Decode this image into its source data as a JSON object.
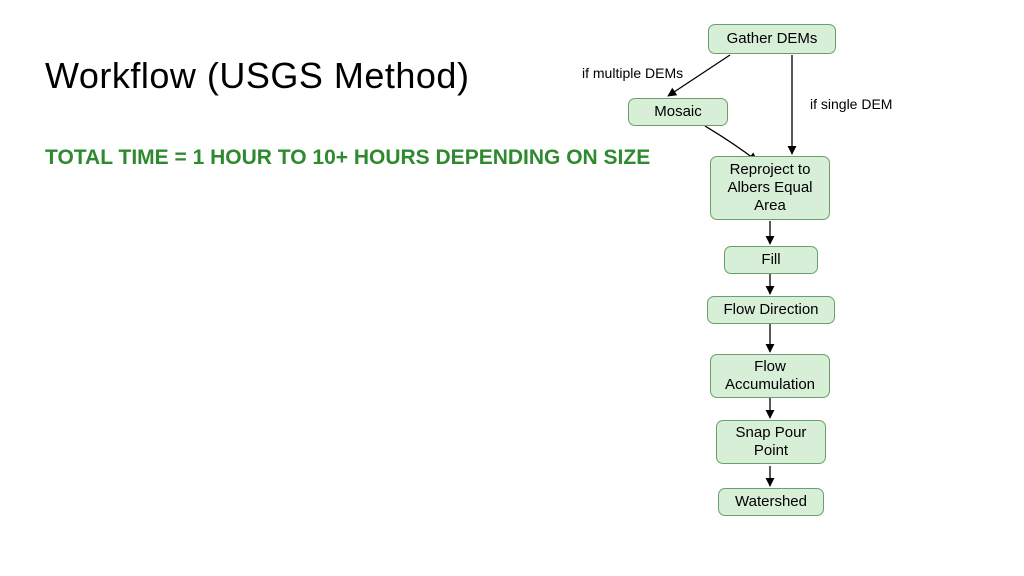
{
  "title": "Workflow (USGS Method)",
  "subtitle": "TOTAL TIME = 1 HOUR TO 10+ HOURS DEPENDING ON SIZE",
  "flow": {
    "nodes": {
      "gather": "Gather DEMs",
      "mosaic": "Mosaic",
      "reproject": "Reproject to Albers Equal Area",
      "fill": "Fill",
      "flowdir": "Flow Direction",
      "flowacc": "Flow Accumulation",
      "snap": "Snap Pour Point",
      "watershed": "Watershed"
    },
    "edge_labels": {
      "multi": "if multiple DEMs",
      "single": "if single DEM"
    },
    "edges": [
      {
        "from": "gather",
        "to": "mosaic",
        "label": "multi"
      },
      {
        "from": "gather",
        "to": "reproject",
        "label": "single"
      },
      {
        "from": "mosaic",
        "to": "reproject"
      },
      {
        "from": "reproject",
        "to": "fill"
      },
      {
        "from": "fill",
        "to": "flowdir"
      },
      {
        "from": "flowdir",
        "to": "flowacc"
      },
      {
        "from": "flowacc",
        "to": "snap"
      },
      {
        "from": "snap",
        "to": "watershed"
      }
    ]
  }
}
